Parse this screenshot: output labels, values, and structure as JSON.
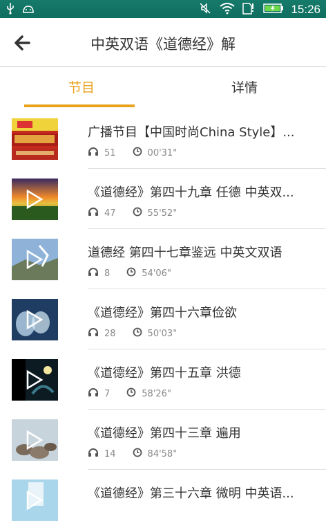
{
  "status": {
    "time": "15:26",
    "icons": [
      "usb-icon",
      "debug-icon",
      "mute-icon",
      "wifi-icon",
      "sim-icon",
      "battery-icon"
    ]
  },
  "header": {
    "title": "中英双语《道德经》解"
  },
  "tabs": [
    {
      "label": "节目",
      "active": true
    },
    {
      "label": "详情",
      "active": false
    }
  ],
  "accent_color": "#e8a21b",
  "items": [
    {
      "title": "广播节目【中国时尚China Style】...",
      "plays": "51",
      "duration": "00'31\""
    },
    {
      "title": "《道德经》第四十九章 任德 中英双...",
      "plays": "47",
      "duration": "55'52\""
    },
    {
      "title": "道德经 第四十七章鉴远 中英文双语",
      "plays": "8",
      "duration": "54'06\""
    },
    {
      "title": "《道德经》第四十六章俭欲",
      "plays": "28",
      "duration": "50'03\""
    },
    {
      "title": "《道德经》第四十五章 洪德",
      "plays": "7",
      "duration": "58'26\""
    },
    {
      "title": "《道德经》第四十三章 遍用",
      "plays": "14",
      "duration": "84'58\""
    },
    {
      "title": "《道德经》第三十六章 微明 中英语...",
      "plays": "",
      "duration": ""
    }
  ]
}
